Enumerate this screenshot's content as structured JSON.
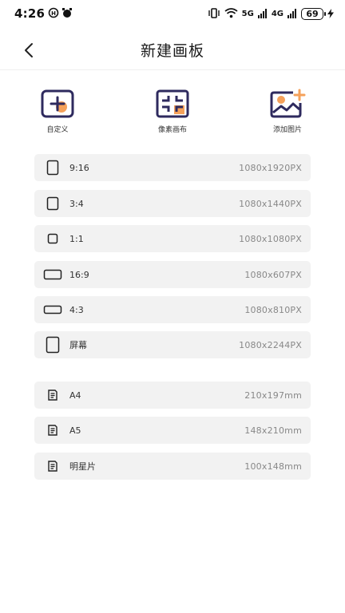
{
  "status": {
    "time": "4:26",
    "network1": "5G",
    "network2": "4G",
    "battery": "69"
  },
  "header": {
    "title": "新建画板"
  },
  "actions": [
    {
      "label": "自定义",
      "icon": "custom-add-icon"
    },
    {
      "label": "像素画布",
      "icon": "pixel-canvas-icon"
    },
    {
      "label": "添加图片",
      "icon": "add-image-icon"
    }
  ],
  "ratios": [
    {
      "label": "9:16",
      "value": "1080x1920PX",
      "shape": "portrait-9-16"
    },
    {
      "label": "3:4",
      "value": "1080x1440PX",
      "shape": "portrait-3-4"
    },
    {
      "label": "1:1",
      "value": "1080x1080PX",
      "shape": "square"
    },
    {
      "label": "16:9",
      "value": "1080x607PX",
      "shape": "landscape-16-9"
    },
    {
      "label": "4:3",
      "value": "1080x810PX",
      "shape": "landscape-4-3"
    },
    {
      "label": "屏幕",
      "value": "1080x2244PX",
      "shape": "screen"
    }
  ],
  "papers": [
    {
      "label": "A4",
      "value": "210x197mm",
      "icon": "document-icon"
    },
    {
      "label": "A5",
      "value": "148x210mm",
      "icon": "document-icon"
    },
    {
      "label": "明星片",
      "value": "100x148mm",
      "icon": "document-icon"
    }
  ],
  "colors": {
    "accent_dark": "#2e2a5e",
    "accent_orange": "#f5a15a",
    "row_bg": "#f2f2f2"
  }
}
